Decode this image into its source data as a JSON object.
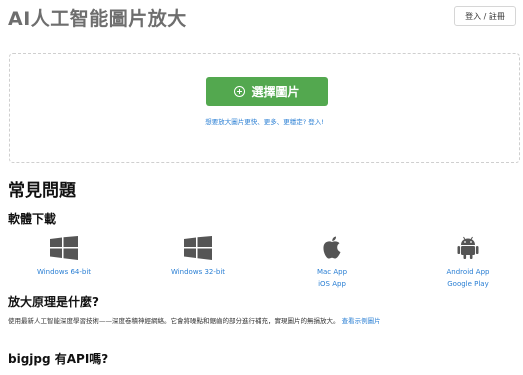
{
  "header": {
    "app_title": "AI人工智能圖片放大",
    "login_label": "登入 / 註冊"
  },
  "upload": {
    "select_label": "選擇圖片",
    "upsell_text": "想要放大圖片更快、更多、更穩定? 登入!"
  },
  "faq": {
    "title": "常見問題",
    "download_heading": "軟體下載",
    "downloads": [
      {
        "icon": "windows-icon",
        "label": "Windows 64-bit"
      },
      {
        "icon": "windows-icon",
        "label": "Windows 32-bit"
      },
      {
        "icon": "apple-icon",
        "label": "Mac App",
        "label2": "iOS App"
      },
      {
        "icon": "android-icon",
        "label": "Android App",
        "label2": "Google Play"
      }
    ],
    "principle_heading": "放大原理是什麼?",
    "principle_text": "使用最新人工智能深度學習技術——深度卷積神經網絡。它會將噪點和鋸齒的部分進行補充，實現圖片的無損放大。",
    "principle_link": "查看示例圖片",
    "api_heading": "bigjpg 有API嗎?"
  },
  "colors": {
    "accent_green": "#53a84f",
    "link_blue": "#2a7fd4",
    "icon_gray": "#555555"
  }
}
